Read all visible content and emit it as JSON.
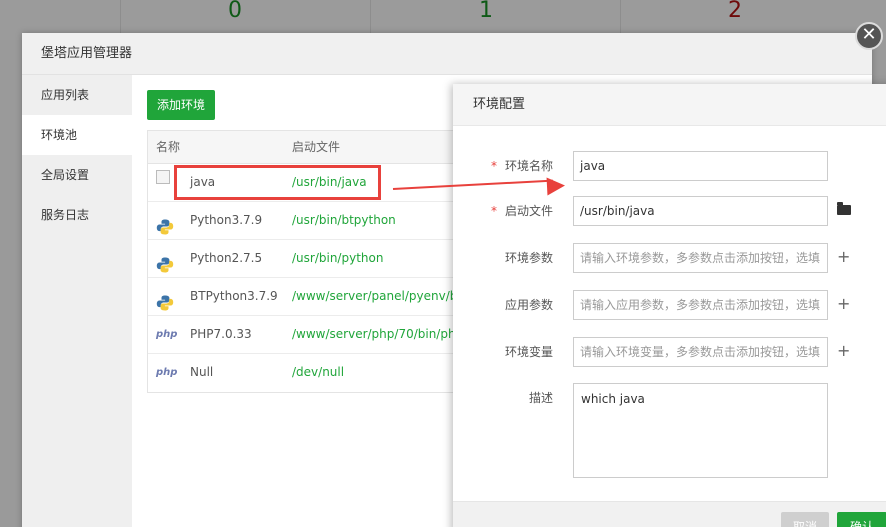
{
  "background": {
    "stats": [
      {
        "value": "0",
        "color": "#0e5a16"
      },
      {
        "value": "1",
        "color": "#0e5a16"
      },
      {
        "value": "2",
        "color": "#6e0a0a"
      }
    ]
  },
  "dialog": {
    "title": "堡塔应用管理器",
    "close_icon": "close-icon",
    "sidebar": [
      {
        "label": "应用列表",
        "active": false
      },
      {
        "label": "环境池",
        "active": true
      },
      {
        "label": "全局设置",
        "active": false
      },
      {
        "label": "服务日志",
        "active": false
      }
    ],
    "add_button": "添加环境",
    "table": {
      "headers": [
        "名称",
        "启动文件"
      ],
      "rows": [
        {
          "icon": "broken-image-icon",
          "name": "java",
          "path": "/usr/bin/java"
        },
        {
          "icon": "python-icon",
          "name": "Python3.7.9",
          "path": "/usr/bin/btpython"
        },
        {
          "icon": "python-icon",
          "name": "Python2.7.5",
          "path": "/usr/bin/python"
        },
        {
          "icon": "python-icon",
          "name": "BTPython3.7.9",
          "path": "/www/server/panel/pyenv/b"
        },
        {
          "icon": "php-icon",
          "name": "PHP7.0.33",
          "path": "/www/server/php/70/bin/ph"
        },
        {
          "icon": "php-icon",
          "name": "Null",
          "path": "/dev/null"
        }
      ]
    }
  },
  "config": {
    "title": "环境配置",
    "fields": {
      "env_name": {
        "label": "环境名称",
        "value": "java",
        "required": true
      },
      "start_file": {
        "label": "启动文件",
        "value": "/usr/bin/java",
        "required": true
      },
      "env_params": {
        "label": "环境参数",
        "placeholder": "请输入环境参数，多参数点击添加按钮，选填"
      },
      "app_params": {
        "label": "应用参数",
        "placeholder": "请输入应用参数，多参数点击添加按钮，选填"
      },
      "env_vars": {
        "label": "环境变量",
        "placeholder": "请输入环境变量，多参数点击添加按钮，选填"
      },
      "description": {
        "label": "描述",
        "value": "which java"
      }
    },
    "required_mark": "*",
    "plus_symbol": "+",
    "php_label": "php",
    "buttons": {
      "cancel": "取消",
      "ok": "确认"
    }
  },
  "colors": {
    "accent": "#20a53a",
    "annotation": "#e8413c"
  }
}
